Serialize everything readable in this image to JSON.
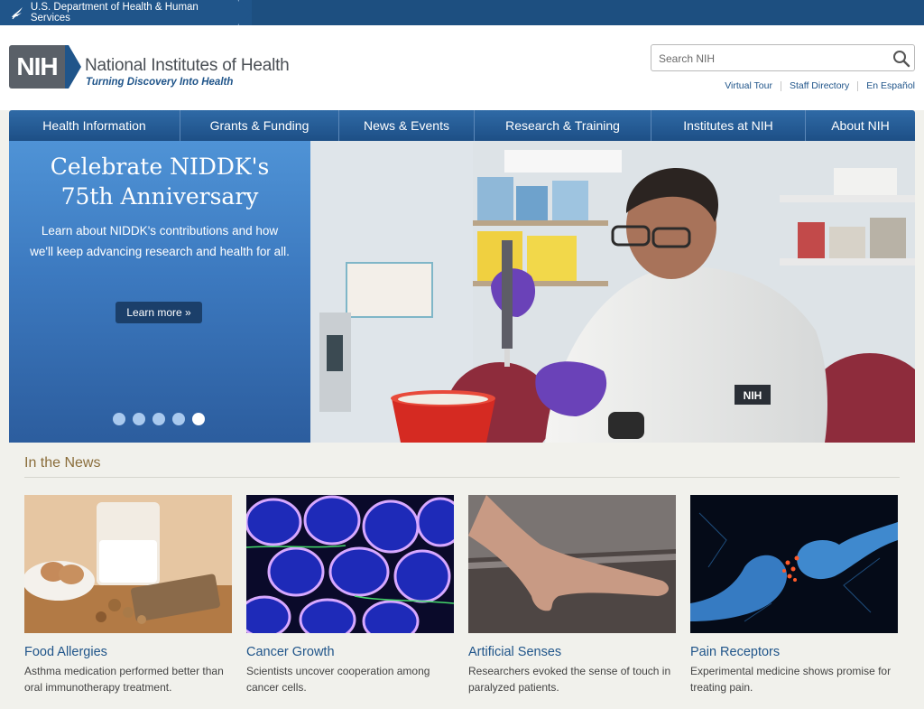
{
  "hhs": {
    "label": "U.S. Department of Health & Human Services"
  },
  "header": {
    "logo_text": "NIH",
    "title": "National Institutes of Health",
    "tagline": "Turning Discovery Into Health",
    "search_placeholder": "Search NIH",
    "links": [
      "Virtual Tour",
      "Staff Directory",
      "En Español"
    ]
  },
  "nav": {
    "items": [
      "Health Information",
      "Grants & Funding",
      "News & Events",
      "Research & Training",
      "Institutes at NIH",
      "About NIH"
    ]
  },
  "hero": {
    "title_line1": "Celebrate NIDDK's",
    "title_line2": "75th Anniversary",
    "description": "Learn about NIDDK's contributions and how we'll keep advancing research and health for all.",
    "button": "Learn more »",
    "badge_text": "NIH",
    "slide_count": 5,
    "active_slide": 5
  },
  "news": {
    "heading": "In the News",
    "cards": [
      {
        "title": "Food Allergies",
        "desc": "Asthma medication performed better than oral immunotherapy treatment."
      },
      {
        "title": "Cancer Growth",
        "desc": "Scientists uncover cooperation among cancer cells."
      },
      {
        "title": "Artificial Senses",
        "desc": "Researchers evoked the sense of touch in paralyzed patients."
      },
      {
        "title": "Pain Receptors",
        "desc": "Experimental medicine shows promise for treating pain."
      }
    ]
  },
  "colors": {
    "brand_blue": "#20558a",
    "nav_top": "#2f6aa6",
    "nav_bottom": "#1d4f86",
    "hero_panel": "#3c79bf",
    "news_heading": "#8a6d3b"
  }
}
